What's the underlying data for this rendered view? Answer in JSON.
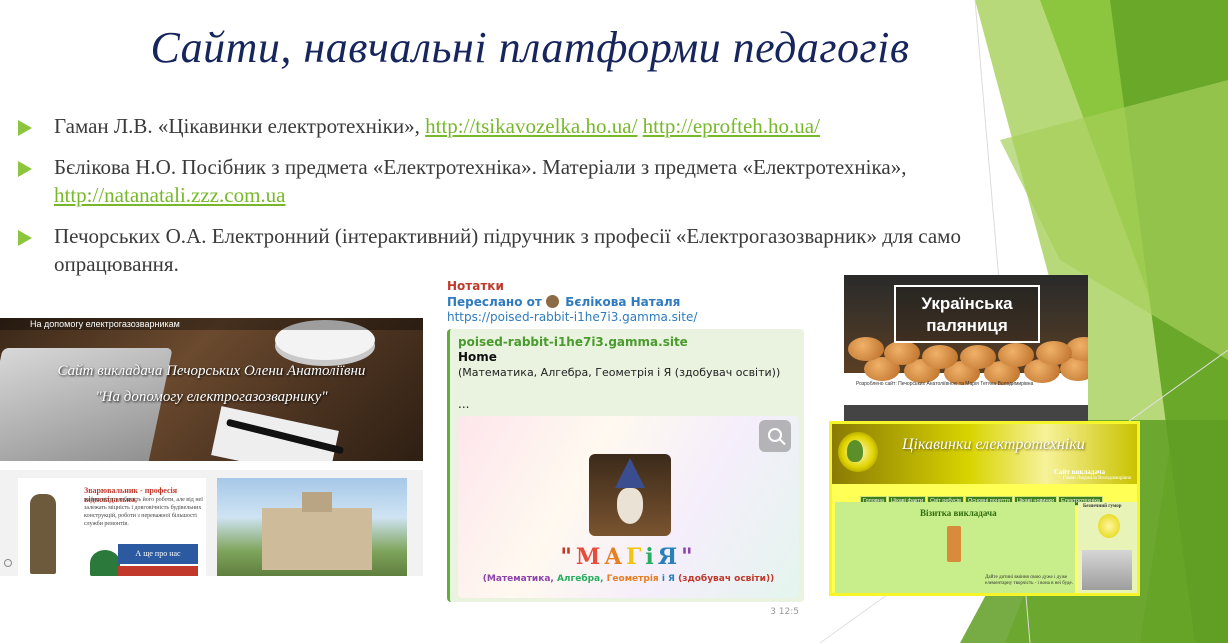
{
  "slide": {
    "title": "Сайти, навчальні платформи педагогів",
    "bullets": [
      {
        "text": "Гаман Л.В. «Цікавинки електротехніки», ",
        "links": [
          "http://tsikavozelka.ho.ua/",
          "http://eprofteh.ho.ua/"
        ]
      },
      {
        "text": "Бєлікова Н.О. Посібник з предмета «Електротехніка». Матеріали з предмета «Електротехніка»,",
        "links": [
          "http://natanatali.zzz.com.ua"
        ]
      },
      {
        "text": "Печорських О.А. Електронний (інтерактивний) підручник з професії «Електрогазозварник» для само опрацювання.",
        "links": []
      }
    ]
  },
  "left_screenshot": {
    "topbar": "На допомогу електрогазозварникам",
    "line1": "Сайт викладача Печорських Олени Анатоліївни",
    "line2": "\"На допомогу електрогазозварнику\"",
    "tile_heading": "Зварювальник - професія відповідальна,",
    "tile_text": "майже ніхто не бачить його роботи, але від неї залежать міцність і довговічність будівельних конструкцій, роботи з переважної більшості служби ремонтів.",
    "tile_button": "А ще про нас"
  },
  "chat": {
    "notes_label": "Нотатки",
    "forwarded_prefix": "Переслано от",
    "forwarded_name": "Бєлікова Наталя",
    "url": "https://poised-rabbit-i1he7i3.gamma.site/",
    "preview_site": "poised-rabbit-i1he7i3.gamma.site",
    "preview_title": "Home",
    "preview_desc": "(Математика, Алгебра, Геометрія і Я (здобувач освіти))",
    "preview_ellipsis": "...",
    "magia_letters": [
      {
        "char": "\"",
        "color": "#c0392b"
      },
      {
        "char": "М",
        "color": "#e74c3c"
      },
      {
        "char": "А",
        "color": "#e67e22"
      },
      {
        "char": "Г",
        "color": "#f1c40f"
      },
      {
        "char": "і",
        "color": "#27ae60"
      },
      {
        "char": "Я",
        "color": "#2980b9"
      },
      {
        "char": "\"",
        "color": "#8e44ad"
      }
    ],
    "subjects": [
      {
        "text": "(Математика, ",
        "color": "#8e44ad"
      },
      {
        "text": "Алгебра, ",
        "color": "#27ae60"
      },
      {
        "text": "Геометрія ",
        "color": "#e67e22"
      },
      {
        "text": "і Я ",
        "color": "#2980b9"
      },
      {
        "text": "(здобувач освіти))",
        "color": "#c0392b"
      }
    ],
    "meta": "3  12:5"
  },
  "right_top_screenshot": {
    "label_line1": "Українська",
    "label_line2": "паляниця",
    "credit": "Розроблено сайт: Печорських Анатоліївною та Марія Тетяна Володимирівна"
  },
  "right_bottom_screenshot": {
    "title": "Цікавинки електротехніки",
    "teacher": "Сайт викладача",
    "teacher_sub": "Гаман Людмила Володимирівна",
    "menu": [
      "Головна",
      "Цікаві факти",
      "Світ ребусів",
      "Основні поняття",
      "Цікаві новинки",
      "Електротехніка"
    ],
    "section": "Візитка викладача",
    "humor": "Безпечний гумор",
    "tail_text": "Дайте дитині вміння свою дуже і дуже елементарну творчість - і вона в неї буде."
  },
  "colors": {
    "title": "#16255c",
    "bullet_arrow": "#8cc63f",
    "link": "#76b82a",
    "body_text": "#3a3a3a"
  }
}
